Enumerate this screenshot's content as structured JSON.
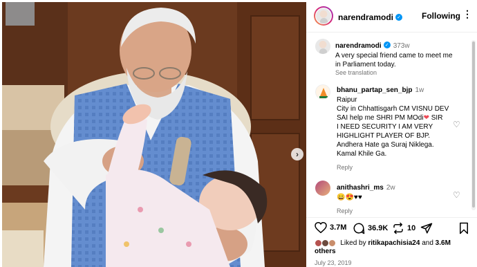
{
  "post": {
    "username": "narendramodi",
    "follow_label": "Following",
    "more_label": "•••"
  },
  "caption": {
    "username": "narendramodi",
    "time": "373w",
    "text_line1": "A very special friend came to meet me",
    "text_line2": "in Parliament today.",
    "see_translation": "See translation"
  },
  "comments": [
    {
      "username": "bhanu_partap_sen_bjp",
      "time": "1w",
      "lines": [
        "Raipur",
        "City in Chhattisgarh CM VISNU DEV",
        "SAI help me SHRI PM MOdi",
        "I NEED SECURITY I AM VERY",
        "HIGHLIGHT PLAYER OF BJP.",
        "Andhera Hate ga Suraj Niklega.",
        "Kamal Khile Ga."
      ],
      "line3_suffix": " SIR",
      "reply": "Reply"
    },
    {
      "username": "anithashri_ms",
      "time": "2w",
      "text": "😄😍♥♥",
      "reply": "Reply"
    }
  ],
  "actions": {
    "likes": "3.7M",
    "comments": "36.9K",
    "reposts": "10"
  },
  "liked_by": {
    "prefix": "Liked by ",
    "user": "ritikapachisia24",
    "middle": " and ",
    "others_count": "3.6M",
    "others_label": "others"
  },
  "date": "July 23, 2019",
  "colors": {
    "verified": "#0095f6",
    "heart_red": "#ed4956",
    "muted": "#737373"
  }
}
